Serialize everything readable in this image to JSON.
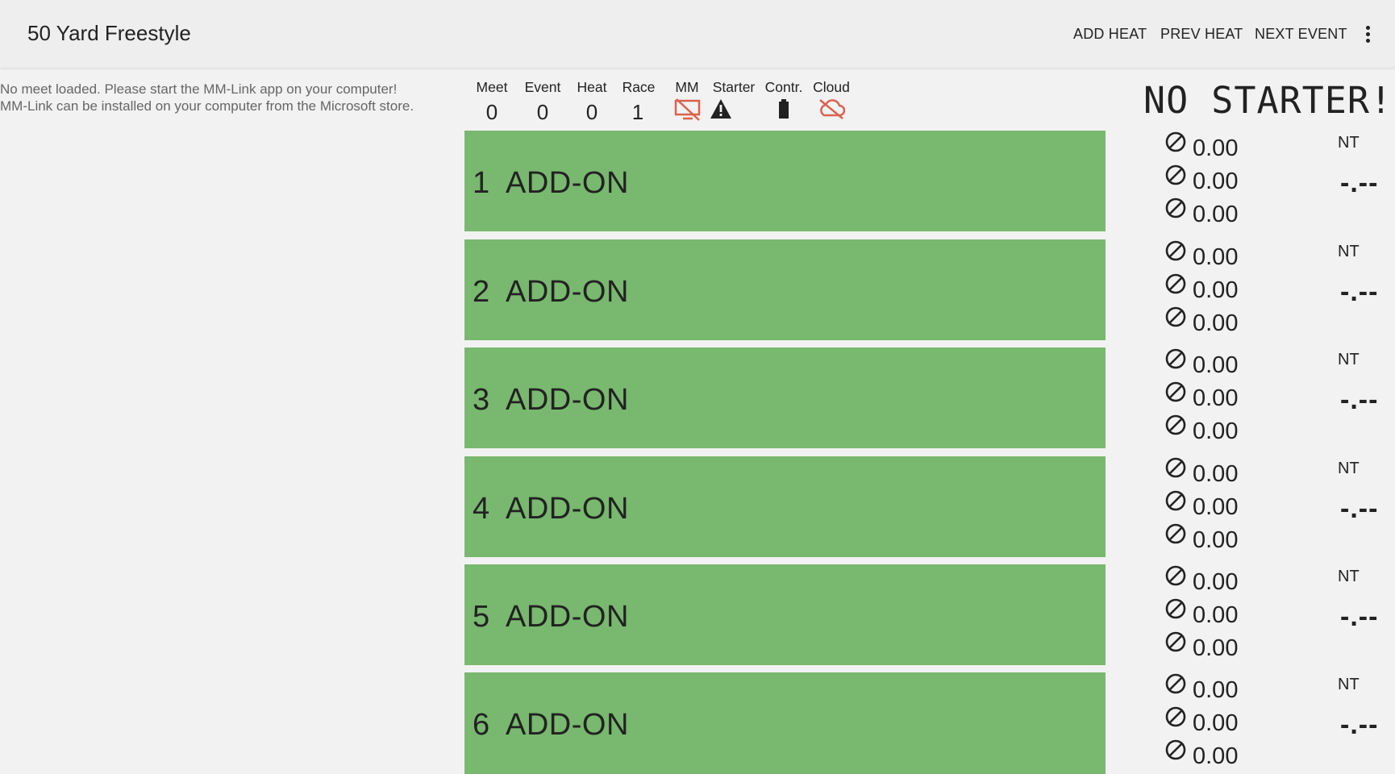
{
  "appbar": {
    "title": "50 Yard Freestyle",
    "actions": {
      "add_heat": "ADD HEAT",
      "prev_heat": "PREV HEAT",
      "next_event": "NEXT EVENT"
    }
  },
  "notice": {
    "line1": "No meet loaded. Please start the MM-Link app on your computer!",
    "line2": "MM-Link can be installed on your computer from the Microsoft store."
  },
  "status": {
    "meet": {
      "label": "Meet",
      "value": "0"
    },
    "event": {
      "label": "Event",
      "value": "0"
    },
    "heat": {
      "label": "Heat",
      "value": "0"
    },
    "race": {
      "label": "Race",
      "value": "1"
    },
    "mm": {
      "label": "MM",
      "icon": "disconnected-display-icon",
      "color": "#d9634f"
    },
    "starter": {
      "label": "Starter",
      "icon": "warning-icon",
      "color": "#222222"
    },
    "contr": {
      "label": "Contr.",
      "icon": "battery-icon",
      "color": "#222222"
    },
    "cloud": {
      "label": "Cloud",
      "icon": "cloud-off-icon",
      "color": "#d9634f"
    }
  },
  "banner": "NO STARTER!",
  "colors": {
    "lane_bg": "#79b86f",
    "alert": "#d9634f",
    "appbar": "#eeeeee"
  },
  "lanes": [
    {
      "number": "1",
      "name": "ADD-ON",
      "splits": [
        "0.00",
        "0.00",
        "0.00"
      ],
      "seed": "NT",
      "final": "-.--"
    },
    {
      "number": "2",
      "name": "ADD-ON",
      "splits": [
        "0.00",
        "0.00",
        "0.00"
      ],
      "seed": "NT",
      "final": "-.--"
    },
    {
      "number": "3",
      "name": "ADD-ON",
      "splits": [
        "0.00",
        "0.00",
        "0.00"
      ],
      "seed": "NT",
      "final": "-.--"
    },
    {
      "number": "4",
      "name": "ADD-ON",
      "splits": [
        "0.00",
        "0.00",
        "0.00"
      ],
      "seed": "NT",
      "final": "-.--"
    },
    {
      "number": "5",
      "name": "ADD-ON",
      "splits": [
        "0.00",
        "0.00",
        "0.00"
      ],
      "seed": "NT",
      "final": "-.--"
    },
    {
      "number": "6",
      "name": "ADD-ON",
      "splits": [
        "0.00",
        "0.00",
        "0.00"
      ],
      "seed": "NT",
      "final": "-.--"
    }
  ]
}
